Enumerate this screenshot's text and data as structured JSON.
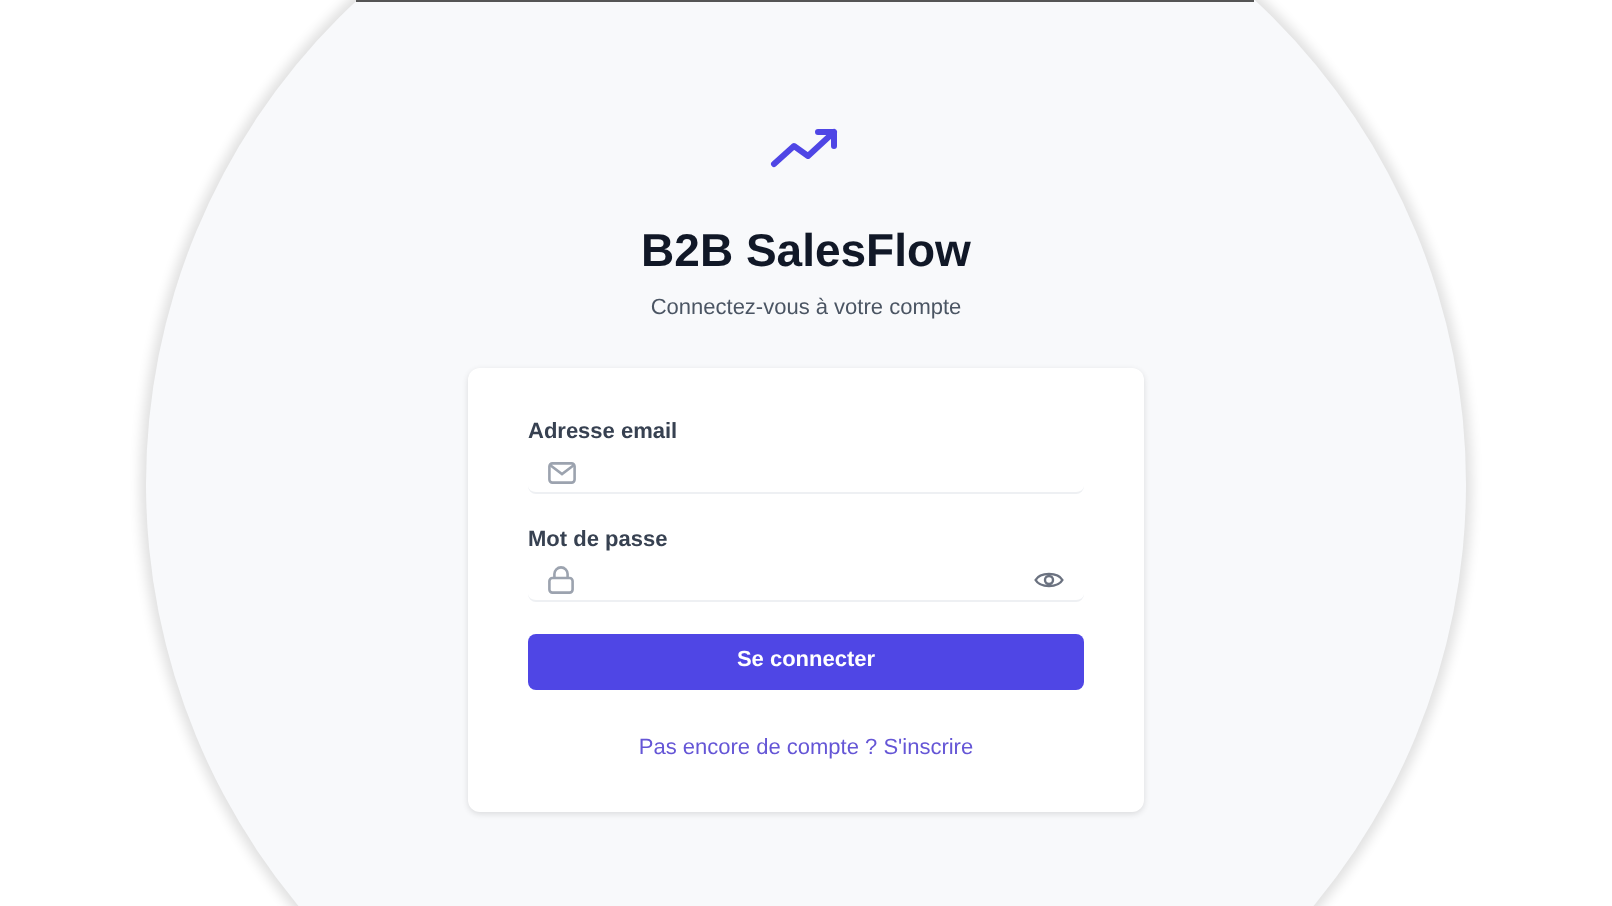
{
  "app": {
    "title": "B2B SalesFlow",
    "subtitle": "Connectez-vous à votre compte"
  },
  "form": {
    "fields": [
      {
        "label": "Adresse email",
        "kind": "email"
      },
      {
        "label": "Mot de passe",
        "kind": "password"
      }
    ],
    "submit_button": "Se connecter",
    "signup_link": "Pas encore de compte ? S'inscrire"
  }
}
